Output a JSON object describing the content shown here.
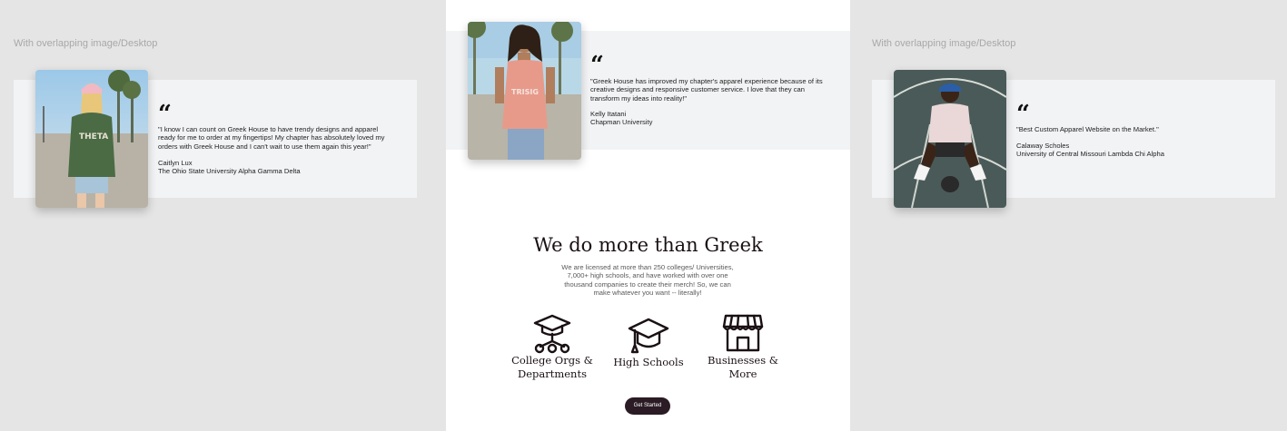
{
  "frame_labels": {
    "left": "With overlapping image/Desktop",
    "right": "With overlapping image/Desktop"
  },
  "testimonials": [
    {
      "quote": "\"I know I can count on Greek House to have trendy designs and apparel ready for me to order at my fingertips! My chapter has absolutely loved my orders with Greek House and I can't wait to use them again this year!\"",
      "name": "Caitlyn Lux",
      "org": "The Ohio State University Alpha Gamma Delta"
    },
    {
      "quote": "\"Greek House has improved my chapter's apparel experience because of its creative designs and responsive customer service. I love that they can transform my ideas into reality!\"",
      "name": "Kelly Itatani",
      "org": "Chapman University"
    },
    {
      "quote": "\"Best Custom Apparel Website on the Market.\"",
      "name": "Calaway Scholes",
      "org": "University of Central Missouri Lambda Chi Alpha"
    }
  ],
  "quote_mark": "“",
  "section": {
    "headline": "We do more than Greek",
    "description": "We are licensed at more than 250 colleges/ Universities, 7,000+ high schools, and have worked with over one thousand companies to create their merch! So, we can make whatever you want -- literally!",
    "categories": [
      {
        "label": "College Orgs & Departments",
        "icon": "graduation-network-icon"
      },
      {
        "label": "High Schools",
        "icon": "graduation-cap-icon"
      },
      {
        "label": "Businesses & More",
        "icon": "storefront-icon"
      }
    ],
    "cta_label": "Get Started"
  },
  "colors": {
    "canvas": "#e5e5e5",
    "card": "#f2f3f5",
    "dark": "#2a1b24"
  }
}
